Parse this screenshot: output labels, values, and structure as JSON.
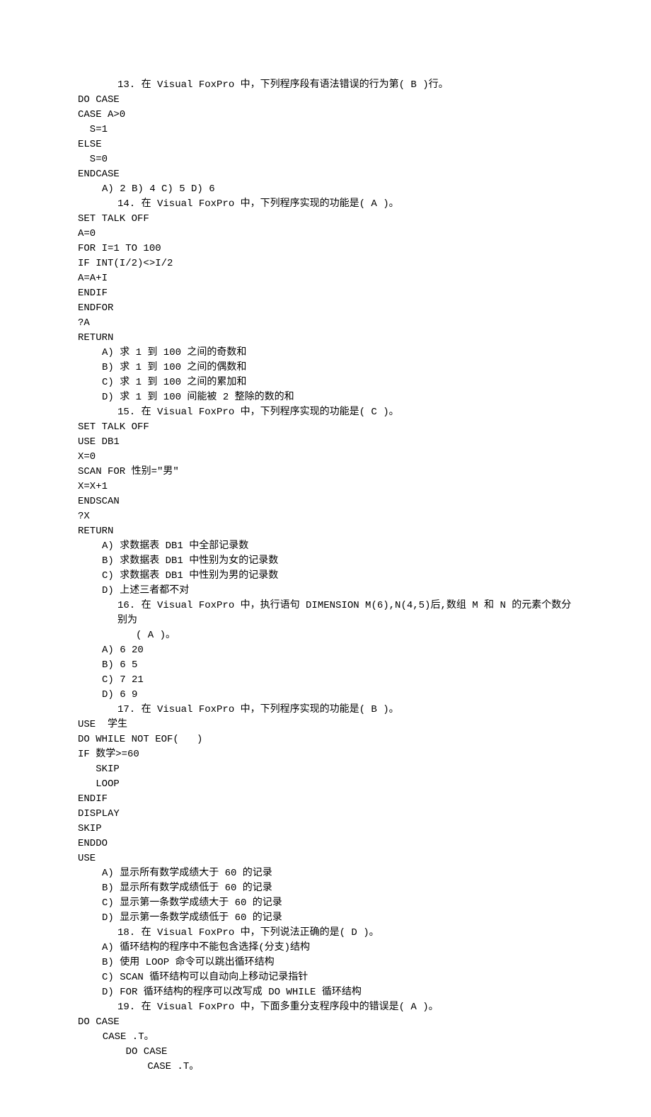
{
  "q13": {
    "stem": "13.  在 Visual FoxPro 中，下列程序段有语法错误的行为第(   B   )行。",
    "code": [
      "DO CASE",
      "CASE A>0",
      "  S=1",
      "ELSE",
      "  S=0",
      "ENDCASE"
    ],
    "opts": "A) 2    B) 4    C) 5    D) 6"
  },
  "q14": {
    "stem": "14.  在 Visual FoxPro 中，下列程序实现的功能是(  A  )。",
    "code": [
      "SET TALK OFF",
      "A=0",
      "FOR I=1 TO 100",
      "IF INT(I/2)<>I/2",
      "A=A+I",
      "ENDIF",
      "ENDFOR",
      "?A",
      "RETURN"
    ],
    "opts": [
      "A) 求 1 到 100 之间的奇数和",
      "B) 求 1 到 100 之间的偶数和",
      "C) 求 1 到 100 之间的累加和",
      "D) 求 1 到 100 间能被 2 整除的数的和"
    ]
  },
  "q15": {
    "stem": "15.  在 Visual FoxPro 中，下列程序实现的功能是(  C  )。",
    "code": [
      "SET TALK OFF",
      "USE DB1",
      "X=0",
      "SCAN FOR 性别=\"男\"",
      "X=X+1",
      "ENDSCAN",
      "?X",
      "RETURN"
    ],
    "opts": [
      "A) 求数据表 DB1 中全部记录数",
      "B) 求数据表 DB1 中性别为女的记录数",
      "C) 求数据表 DB1 中性别为男的记录数",
      "D) 上述三者都不对"
    ]
  },
  "q16": {
    "stem": "16.  在 Visual FoxPro 中，执行语句 DIMENSION M(6),N(4,5)后,数组 M 和 N 的元素个数分别为",
    "stem2": "(  A  )。",
    "opts": [
      "A) 6 20",
      "B) 6 5",
      "C) 7 21",
      "D) 6 9"
    ]
  },
  "q17": {
    "stem": "17.  在 Visual FoxPro 中，下列程序实现的功能是(  B  )。",
    "code": [
      "USE  学生",
      "DO WHILE NOT EOF(   )",
      "IF 数学>=60",
      "   SKIP",
      "   LOOP",
      "ENDIF",
      "DISPLAY",
      "SKIP",
      "ENDDO",
      "USE"
    ],
    "opts": [
      "A) 显示所有数学成绩大于 60 的记录",
      "B) 显示所有数学成绩低于 60 的记录",
      "C) 显示第一条数学成绩大于 60 的记录",
      "D) 显示第一条数学成绩低于 60 的记录"
    ]
  },
  "q18": {
    "stem": "18.  在 Visual FoxPro 中，下列说法正确的是(  D  )。",
    "opts": [
      "A) 循环结构的程序中不能包含选择(分支)结构",
      "B) 使用 LOOP 命令可以跳出循环结构",
      "C) SCAN 循环结构可以自动向上移动记录指针",
      "D) FOR 循环结构的程序可以改写成 DO WHILE 循环结构"
    ]
  },
  "q19": {
    "stem": "19.  在 Visual FoxPro 中，下面多重分支程序段中的错误是(  A  )。",
    "code": [
      "DO CASE",
      "  CASE .T。",
      "    DO CASE",
      "      CASE .T。"
    ]
  }
}
